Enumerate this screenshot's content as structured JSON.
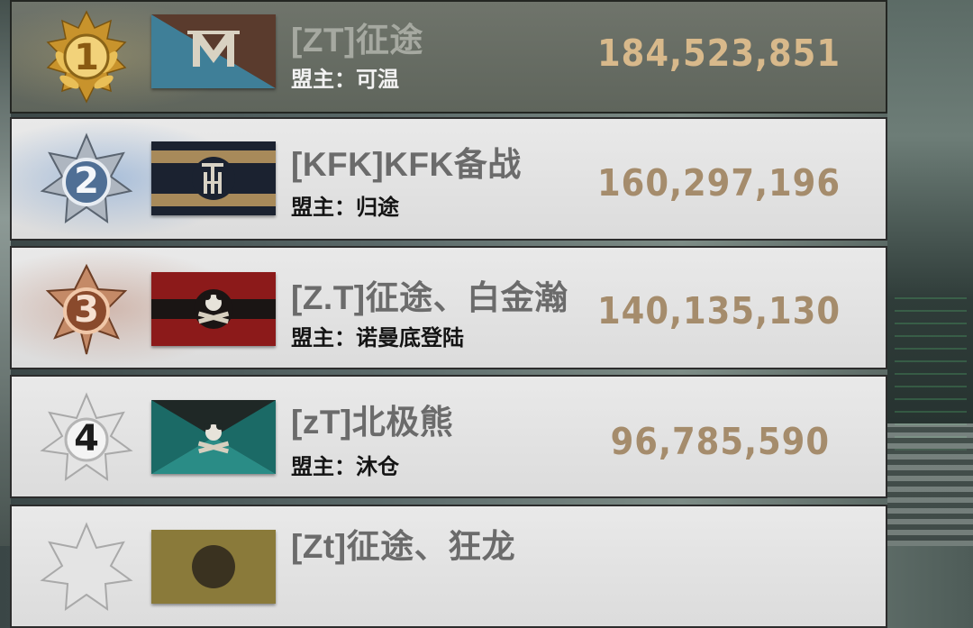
{
  "colors": {
    "score": "#a58c6c",
    "score_first": "#d8b98b",
    "gold_badge": "#d6a93a",
    "silver_badge": "#b8bfc8",
    "bronze_badge": "#b8805e"
  },
  "leaderboard": {
    "leader_prefix": "盟主：",
    "rows": [
      {
        "rank": "1",
        "name": "[ZT]征途",
        "leader": "盟主：可温",
        "score": "184,523,851",
        "badge_icon": "gold-laurel-rank-badge-icon",
        "flag_icon": "blue-brown-m-emblem-flag-icon"
      },
      {
        "rank": "2",
        "name": "[KFK]KFK备战",
        "leader": "盟主：归途",
        "score": "160,297,196",
        "badge_icon": "silver-star-rank-badge-icon",
        "flag_icon": "striped-th-emblem-flag-icon"
      },
      {
        "rank": "3",
        "name": "[Z.T]征途、白金瀚",
        "leader": "盟主：诺曼底登陆",
        "score": "140,135,130",
        "badge_icon": "bronze-star-rank-badge-icon",
        "flag_icon": "red-panda-emblem-flag-icon"
      },
      {
        "rank": "4",
        "name": "[zT]北极熊",
        "leader": "盟主：沐仓",
        "score": "96,785,590",
        "badge_icon": "white-star-rank-badge-icon",
        "flag_icon": "teal-panda-emblem-flag-icon"
      },
      {
        "rank": "",
        "name": "[Zt]征途、狂龙",
        "leader": "",
        "score": "",
        "badge_icon": "white-star-rank-badge-icon",
        "flag_icon": "olive-emblem-flag-icon"
      }
    ]
  }
}
